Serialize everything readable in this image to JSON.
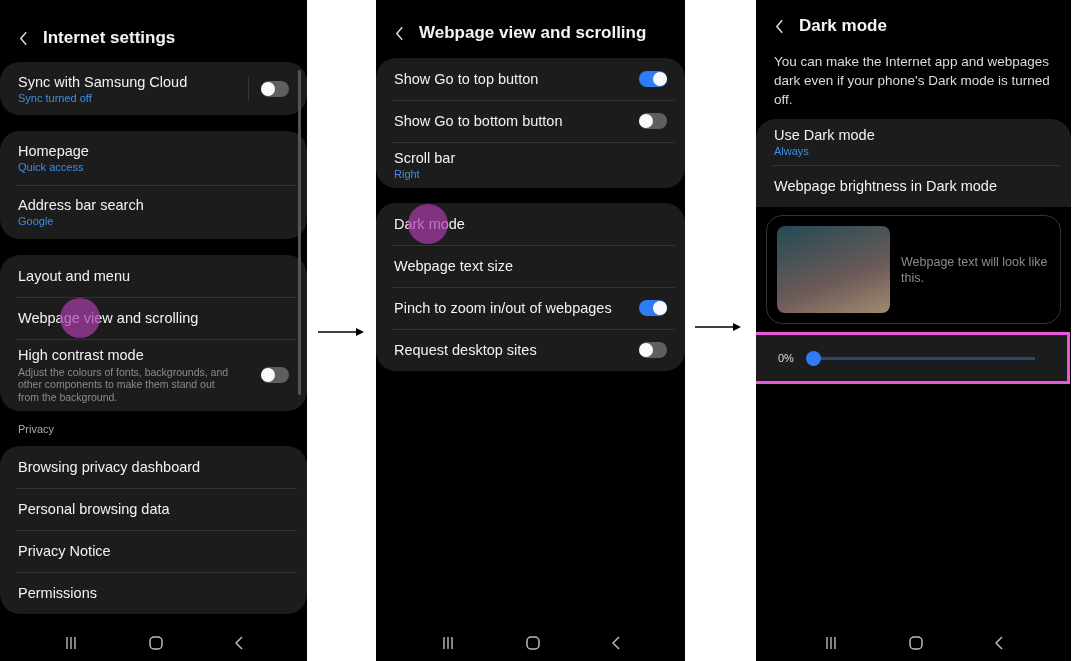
{
  "screens": [
    {
      "title": "Internet settings",
      "scrollbar": true,
      "sections": [
        {
          "kind": "card",
          "items": [
            {
              "kind": "toggle",
              "label": "Sync with Samsung Cloud",
              "sub": "Sync turned off",
              "on": false,
              "touched": false
            }
          ]
        },
        {
          "kind": "card",
          "items": [
            {
              "kind": "link",
              "label": "Homepage",
              "sub": "Quick access",
              "touched": false
            },
            {
              "kind": "link",
              "label": "Address bar search",
              "sub": "Google",
              "touched": false
            }
          ]
        },
        {
          "kind": "card",
          "items": [
            {
              "kind": "link",
              "label": "Layout and menu",
              "touched": false
            },
            {
              "kind": "link",
              "label": "Webpage view and scrolling",
              "touched": true
            },
            {
              "kind": "toggle",
              "label": "High contrast mode",
              "description": "Adjust the colours of fonts, backgrounds, and other components to make them stand out from the background.",
              "on": false,
              "touched": false
            }
          ]
        },
        {
          "kind": "header",
          "text": "Privacy"
        },
        {
          "kind": "card",
          "items": [
            {
              "kind": "link",
              "label": "Browsing privacy dashboard",
              "touched": false
            },
            {
              "kind": "link",
              "label": "Personal browsing data",
              "touched": false
            },
            {
              "kind": "link",
              "label": "Privacy Notice",
              "touched": false
            },
            {
              "kind": "link",
              "label": "Permissions",
              "touched": false
            }
          ]
        }
      ]
    },
    {
      "title": "Webpage view and scrolling",
      "scrollbar": false,
      "sections": [
        {
          "kind": "card",
          "items": [
            {
              "kind": "toggle",
              "label": "Show Go to top button",
              "on": true,
              "touched": false
            },
            {
              "kind": "toggle",
              "label": "Show Go to bottom button",
              "on": false,
              "touched": false
            },
            {
              "kind": "link",
              "label": "Scroll bar",
              "sub": "Right",
              "touched": false
            }
          ]
        },
        {
          "kind": "card",
          "items": [
            {
              "kind": "link",
              "label": "Dark mode",
              "touched": true
            },
            {
              "kind": "link",
              "label": "Webpage text size",
              "touched": false
            },
            {
              "kind": "toggle",
              "label": "Pinch to zoom in/out of webpages",
              "on": true,
              "touched": false
            },
            {
              "kind": "toggle",
              "label": "Request desktop sites",
              "on": false,
              "touched": false
            }
          ]
        }
      ]
    },
    {
      "title": "Dark mode",
      "scrollbar": false,
      "sections": [
        {
          "kind": "description",
          "text": "You can make the Internet app and webpages dark even if your phone's Dark mode is turned off."
        },
        {
          "kind": "card",
          "items": [
            {
              "kind": "link",
              "label": "Use Dark mode",
              "sub": "Always",
              "touched": false
            },
            {
              "kind": "link",
              "label": "Webpage brightness in Dark mode",
              "touched": false
            }
          ]
        },
        {
          "kind": "preview",
          "text": "Webpage text will look like this."
        },
        {
          "kind": "slider",
          "reading": "0%",
          "level": 0,
          "highlighted": true
        }
      ]
    }
  ]
}
